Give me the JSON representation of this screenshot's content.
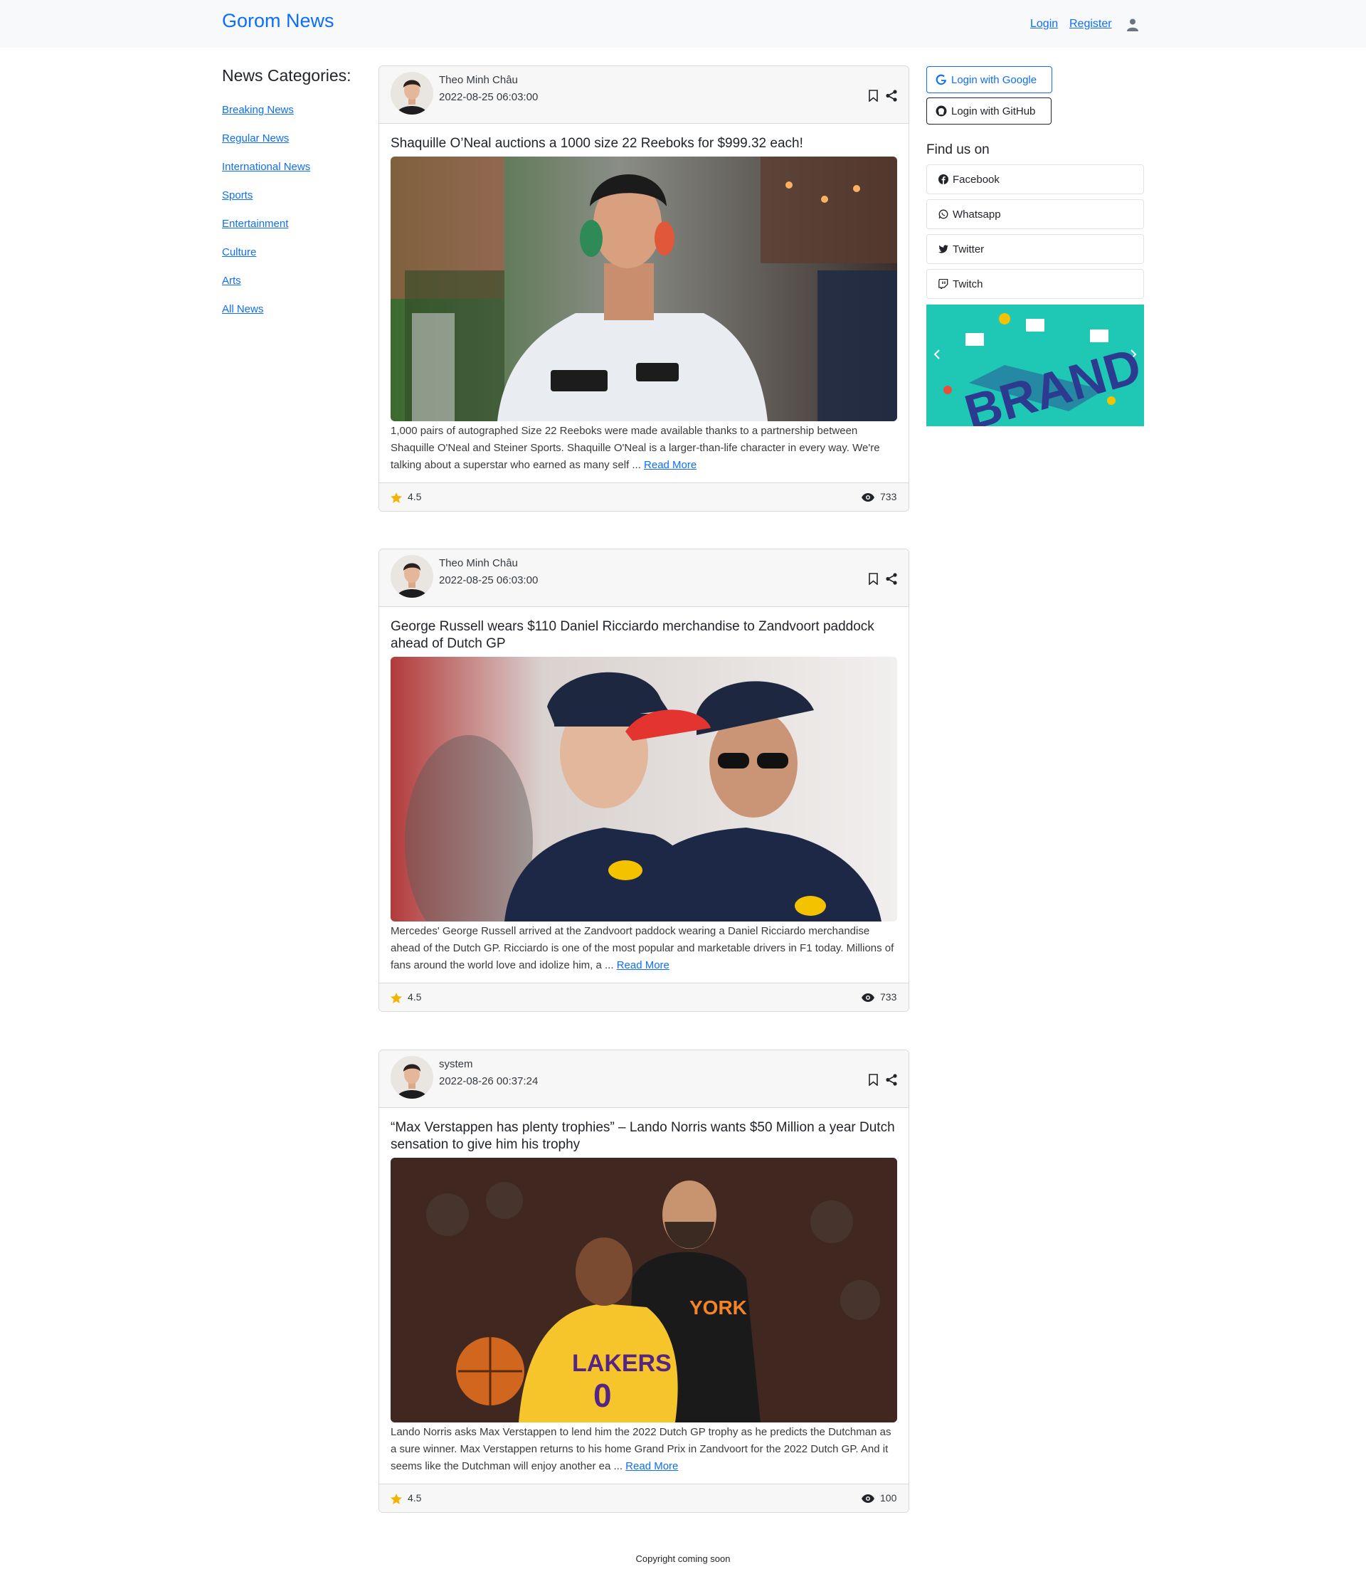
{
  "navbar": {
    "brand": "Gorom News",
    "login": "Login",
    "register": "Register",
    "user_icon": "user-icon"
  },
  "sidebar": {
    "title": "News Categories:",
    "items": [
      {
        "label": "Breaking News"
      },
      {
        "label": "Regular News"
      },
      {
        "label": "International News"
      },
      {
        "label": "Sports"
      },
      {
        "label": "Entertainment"
      },
      {
        "label": "Culture"
      },
      {
        "label": "Arts"
      },
      {
        "label": "All News"
      }
    ]
  },
  "posts": [
    {
      "author": "Theo Minh Châu",
      "date": "2022-08-25 06:03:00",
      "title": "Shaquille O’Neal auctions a 1000 size 22 Reeboks for $999.32 each!",
      "excerpt": "1,000 pairs of autographed Size 22 Reeboks were made available thanks to a partnership between Shaquille O'Neal and Steiner Sports. Shaquille O'Neal is a larger-than-life character in every way. We're talking about a superstar who earned as many self ... ",
      "read_more": "Read More",
      "rating": "4.5",
      "views": "733"
    },
    {
      "author": "Theo Minh Châu",
      "date": "2022-08-25 06:03:00",
      "title": "George Russell wears $110 Daniel Ricciardo merchandise to Zandvoort paddock ahead of Dutch GP",
      "excerpt": "Mercedes' George Russell arrived at the Zandvoort paddock wearing a Daniel Ricciardo merchandise ahead of the Dutch GP. Ricciardo is one of the most popular and marketable drivers in F1 today. Millions of fans around the world love and idolize him, a ... ",
      "read_more": "Read More",
      "rating": "4.5",
      "views": "733"
    },
    {
      "author": "system",
      "date": "2022-08-26 00:37:24",
      "title": "“Max Verstappen has plenty trophies” – Lando Norris wants $50 Million a year Dutch sensation to give him his trophy",
      "excerpt": "Lando Norris asks Max Verstappen to lend him the 2022 Dutch GP trophy as he predicts the Dutchman as a sure winner. Max Verstappen returns to his home Grand Prix in Zandvoort for the 2022 Dutch GP. And it seems like the Dutchman will enjoy another ea ... ",
      "read_more": "Read More",
      "rating": "4.5",
      "views": "100"
    }
  ],
  "right": {
    "google_login": "Login with Google",
    "github_login": "Login with GitHub",
    "find_title": "Find us on",
    "social": [
      {
        "label": "Facebook",
        "icon": "facebook-icon"
      },
      {
        "label": "Whatsapp",
        "icon": "whatsapp-icon"
      },
      {
        "label": "Twitter",
        "icon": "twitter-icon"
      },
      {
        "label": "Twitch",
        "icon": "twitch-icon"
      }
    ],
    "banner_text": "BRAND"
  },
  "footer": {
    "text": "Copyright coming soon"
  },
  "colors": {
    "accent": "#0d6efd",
    "navbar_bg": "#f8f9fa",
    "card_header_bg": "#f7f7f7",
    "star": "#f5b301",
    "banner_bg": "#1fc8b4"
  }
}
